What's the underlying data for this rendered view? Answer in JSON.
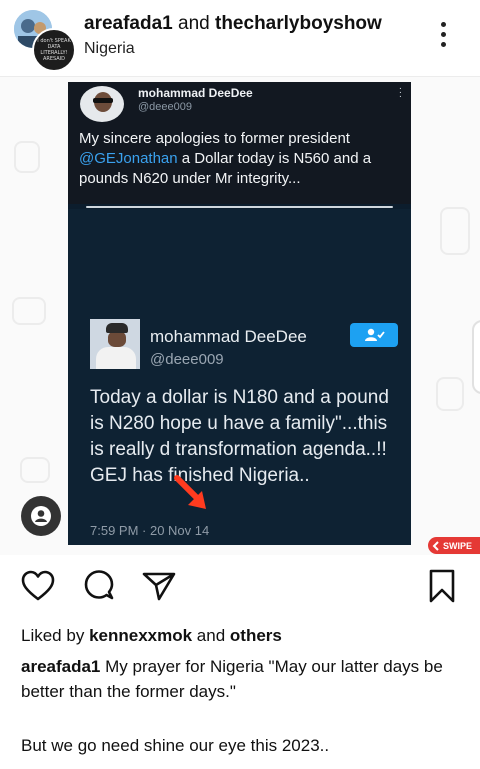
{
  "header": {
    "user1": "areafada1",
    "joiner": "and",
    "user2": "thecharlyboyshow",
    "location": "Nigeria",
    "avatar_text": "I don't SPEAK DATA LITERALLY! ARESAID"
  },
  "tweet": {
    "author_name": "mohammad DeeDee",
    "author_handle": "@deee009",
    "text_before": "My sincere apologies to former president ",
    "mention": "@GEJonathan",
    "text_after": " a Dollar today is N560 and a pounds N620 under Mr integrity..."
  },
  "quoted_tweet": {
    "author_name": "mohammad  DeeDee",
    "author_handle": "@deee009",
    "text": "Today a dollar is N180 and a pound is N280 hope u have a family\"...this is really d transformation agenda..!! GEJ has finished Nigeria..",
    "timestamp": "7:59 PM · 20 Nov 14"
  },
  "swipe_label": "SWIPE",
  "actions": {
    "like": "heart-icon",
    "comment": "comment-icon",
    "share": "send-icon",
    "save": "bookmark-icon"
  },
  "likes": {
    "prefix": "Liked by",
    "user": "kennexxmok",
    "joiner": "and",
    "others": "others"
  },
  "caption": {
    "user": "areafada1",
    "text": "My prayer for Nigeria \"May our  latter days be better than the former days.\"",
    "extra": "But we go need shine our eye this 2023.."
  },
  "colors": {
    "accent_red": "#e53935",
    "twitter_blue": "#1da1f2",
    "mention_blue": "#3aa1ee"
  }
}
